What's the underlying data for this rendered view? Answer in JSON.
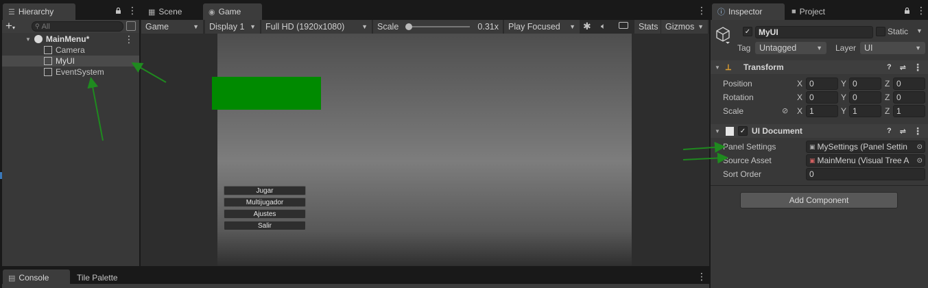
{
  "hierarchy": {
    "tab_label": "Hierarchy",
    "search_placeholder": "All",
    "add_symbol": "+",
    "root": "MainMenu*",
    "items": [
      "Camera",
      "MyUI",
      "EventSystem"
    ],
    "selected": "MyUI"
  },
  "center_tabs": [
    "Scene",
    "Game"
  ],
  "game_toolbar": {
    "display_mode": "Game",
    "display": "Display 1",
    "resolution": "Full HD (1920x1080)",
    "scale_label": "Scale",
    "scale_value": "0.31x",
    "play_mode": "Play Focused",
    "stats": "Stats",
    "gizmos": "Gizmos"
  },
  "game_view": {
    "buttons": [
      "Jugar",
      "Multijugador",
      "Ajustes",
      "Salir"
    ],
    "green_rect_color": "#008a00"
  },
  "bottom_tabs": [
    "Console",
    "Tile Palette"
  ],
  "inspector": {
    "tab_label": "Inspector",
    "project_tab": "Project",
    "object_name": "MyUI",
    "static_label": "Static",
    "tag_label": "Tag",
    "tag_value": "Untagged",
    "layer_label": "Layer",
    "layer_value": "UI",
    "transform": {
      "title": "Transform",
      "rows": [
        {
          "label": "Position",
          "x": "0",
          "y": "0",
          "z": "0"
        },
        {
          "label": "Rotation",
          "x": "0",
          "y": "0",
          "z": "0"
        },
        {
          "label": "Scale",
          "x": "1",
          "y": "1",
          "z": "1"
        }
      ],
      "axis_labels": [
        "X",
        "Y",
        "Z"
      ]
    },
    "ui_document": {
      "title": "UI Document",
      "panel_settings_label": "Panel Settings",
      "panel_settings_value": "MySettings (Panel Settin",
      "source_asset_label": "Source Asset",
      "source_asset_value": "MainMenu (Visual Tree A",
      "sort_order_label": "Sort Order",
      "sort_order_value": "0"
    },
    "add_component": "Add Component"
  },
  "colors": {
    "annotation_arrow": "#1f8a1f",
    "accent_blue": "#3a79bb"
  }
}
